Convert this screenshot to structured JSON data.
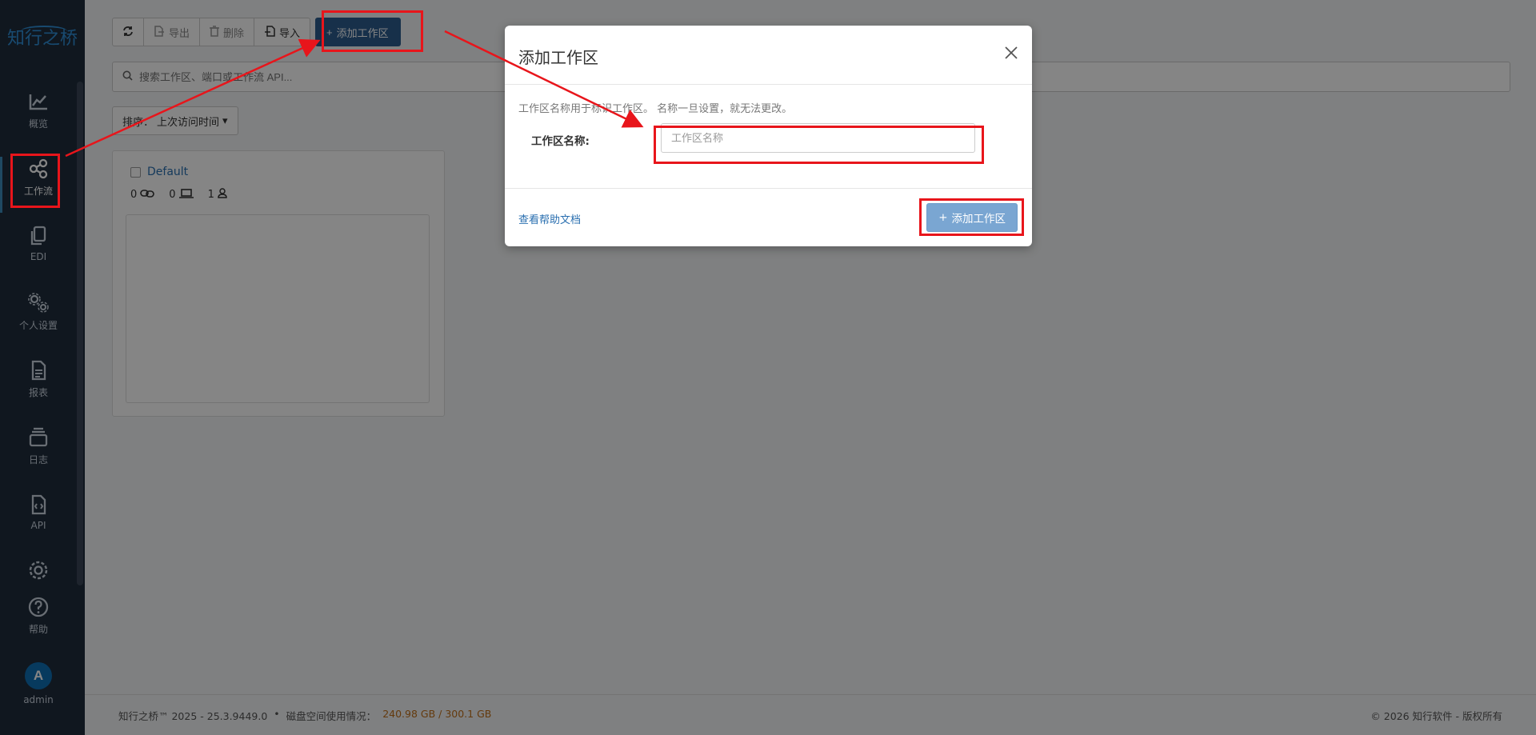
{
  "app": {
    "logo_text": "知行之桥",
    "brand_color": "#2f8fd6",
    "sidebar_bg": "#1f2d3d"
  },
  "sidebar": {
    "items": [
      {
        "label": "概览",
        "icon": "chart-line-icon"
      },
      {
        "label": "工作流",
        "icon": "share-nodes-icon",
        "active": true
      },
      {
        "label": "EDI",
        "icon": "copy-icon"
      },
      {
        "label": "个人设置",
        "icon": "gears-icon"
      },
      {
        "label": "报表",
        "icon": "file-text-icon"
      },
      {
        "label": "日志",
        "icon": "stack-icon"
      },
      {
        "label": "API",
        "icon": "file-code-icon"
      },
      {
        "label": "",
        "icon": "gear-icon"
      },
      {
        "label": "帮助",
        "icon": "question-circle-icon"
      }
    ],
    "user": {
      "initial": "A",
      "name": "admin"
    }
  },
  "toolbar": {
    "refresh_icon": "refresh-icon",
    "export_label": "导出",
    "delete_label": "删除",
    "import_label": "导入",
    "add_label": "添加工作区",
    "primary_color": "#2c5d8f"
  },
  "search": {
    "placeholder": "搜索工作区、端口或工作流 API..."
  },
  "sort": {
    "label": "排序：",
    "value": "上次访问时间"
  },
  "workspace_card": {
    "name": "Default",
    "stats": [
      {
        "value": "0",
        "icon": "link-icon"
      },
      {
        "value": "0",
        "icon": "laptop-icon"
      },
      {
        "value": "1",
        "icon": "user-icon"
      }
    ]
  },
  "footer": {
    "version": "知行之桥™ 2025 - 25.3.9449.0",
    "bullet": "•",
    "disk_label": "磁盘空间使用情况：",
    "disk_value": "240.98 GB / 300.1 GB",
    "copyright": "© 2026 知行软件 - 版权所有",
    "disk_color": "#c0701a"
  },
  "modal": {
    "title": "添加工作区",
    "help_text": "工作区名称用于标识工作区。 名称一旦设置，就无法更改。",
    "field_label": "工作区名称:",
    "input_placeholder": "工作区名称",
    "input_value": "",
    "help_link": "查看帮助文档",
    "submit_label": "添加工作区",
    "submit_color": "#7aa6d2"
  },
  "annotations": {
    "highlight_color": "#e8151b"
  }
}
